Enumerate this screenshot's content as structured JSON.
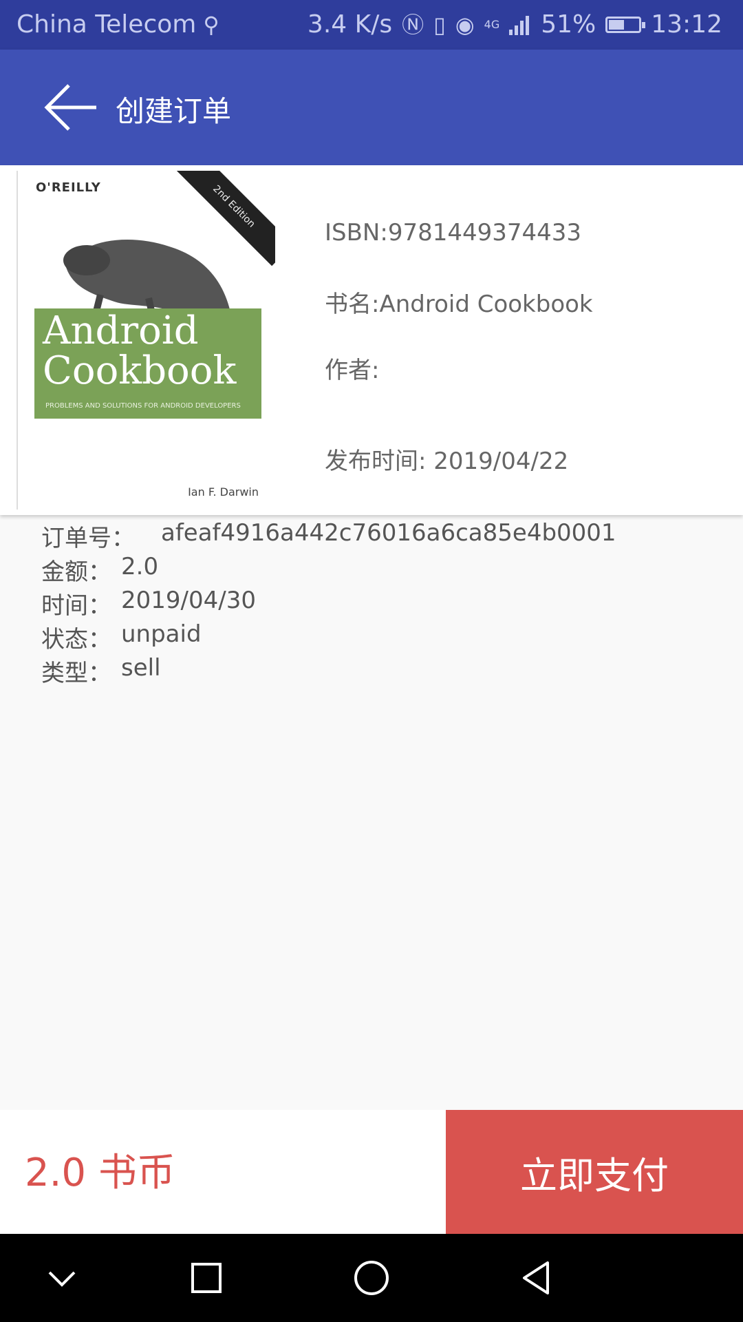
{
  "status_bar": {
    "carrier": "China Telecom",
    "net_speed": "3.4 K/s",
    "battery_percent": "51%",
    "time": "13:12",
    "network_type": "4G",
    "icons": [
      "usb-icon",
      "nfc-icon",
      "vibrate-icon",
      "eye-comfort-icon",
      "signal-icon",
      "battery-icon"
    ]
  },
  "toolbar": {
    "title": "创建订单"
  },
  "book": {
    "isbn": "ISBN:9781449374433",
    "name": "书名:Android Cookbook",
    "author": "作者:",
    "publish_date": "发布时间: 2019/04/22",
    "cover": {
      "publisher": "O'REILLY",
      "edition": "2nd Edition",
      "title_line1": "Android",
      "title_line2": "Cookbook",
      "subtitle": "PROBLEMS AND SOLUTIONS FOR ANDROID DEVELOPERS",
      "author": "Ian F. Darwin"
    }
  },
  "order": {
    "order_no_label": "订单号：",
    "order_no": "afeaf4916a442c76016a6ca85e4b0001",
    "amount_label": "金额：",
    "amount": "2.0",
    "time_label": "时间：",
    "time": "2019/04/30",
    "status_label": "状态：",
    "status": "unpaid",
    "type_label": "类型：",
    "type": "sell"
  },
  "bottom": {
    "price": "2.0 书币",
    "pay_label": "立即支付"
  },
  "colors": {
    "status_bar": "#2f3d9c",
    "toolbar": "#3f51b5",
    "accent_red": "#d9534f"
  }
}
